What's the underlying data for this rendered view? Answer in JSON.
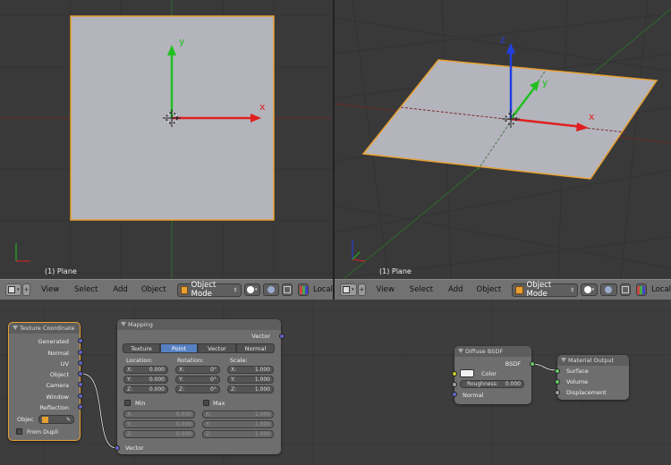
{
  "viewport_left": {
    "label": "(1) Plane",
    "axis_x": "x",
    "axis_y": "y"
  },
  "viewport_right": {
    "label": "(1) Plane",
    "axis_x": "x",
    "axis_y": "y",
    "axis_z": "z"
  },
  "header": {
    "view": "View",
    "select": "Select",
    "add": "Add",
    "object": "Object",
    "mode": "Object Mode",
    "local": "Local"
  },
  "nodes": {
    "texcoord": {
      "title": "Texture Coordinate",
      "outputs": [
        "Generated",
        "Normal",
        "UV",
        "Object",
        "Camera",
        "Window",
        "Reflection"
      ],
      "object_label": "Objec",
      "from_dupli": "From Dupli"
    },
    "mapping": {
      "title": "Mapping",
      "output": "Vector",
      "tabs": [
        "Texture",
        "Point",
        "Vector",
        "Normal"
      ],
      "active_tab": "Point",
      "location_label": "Location:",
      "rotation_label": "Rotation:",
      "scale_label": "Scale:",
      "location": [
        {
          "k": "X:",
          "v": "0.000"
        },
        {
          "k": "Y:",
          "v": "0.000"
        },
        {
          "k": "Z:",
          "v": "0.000"
        }
      ],
      "rotation": [
        {
          "k": "X:",
          "v": "0°"
        },
        {
          "k": "Y:",
          "v": "0°"
        },
        {
          "k": "Z:",
          "v": "0°"
        }
      ],
      "scale": [
        {
          "k": "X:",
          "v": "1.000"
        },
        {
          "k": "Y:",
          "v": "1.000"
        },
        {
          "k": "Z:",
          "v": "1.000"
        }
      ],
      "min_label": "Min",
      "max_label": "Max",
      "min": [
        {
          "k": "X:",
          "v": "0.000"
        },
        {
          "k": "Y:",
          "v": "0.000"
        },
        {
          "k": "Z:",
          "v": "0.000"
        }
      ],
      "max": [
        {
          "k": "X:",
          "v": "1.000"
        },
        {
          "k": "Y:",
          "v": "1.000"
        },
        {
          "k": "Z:",
          "v": "1.000"
        }
      ],
      "input": "Vector"
    },
    "diffuse": {
      "title": "Diffuse BSDF",
      "output": "BSDF",
      "color": "Color",
      "roughness_label": "Roughness:",
      "roughness": "0.000",
      "normal": "Normal"
    },
    "output": {
      "title": "Material Output",
      "inputs": [
        "Surface",
        "Volume",
        "Displacement"
      ]
    }
  },
  "colors": {
    "selection": "#e8a030",
    "x_axis": "#e02020",
    "y_axis": "#20c020",
    "z_axis": "#2040e0",
    "plane": "#b4b4bc"
  }
}
